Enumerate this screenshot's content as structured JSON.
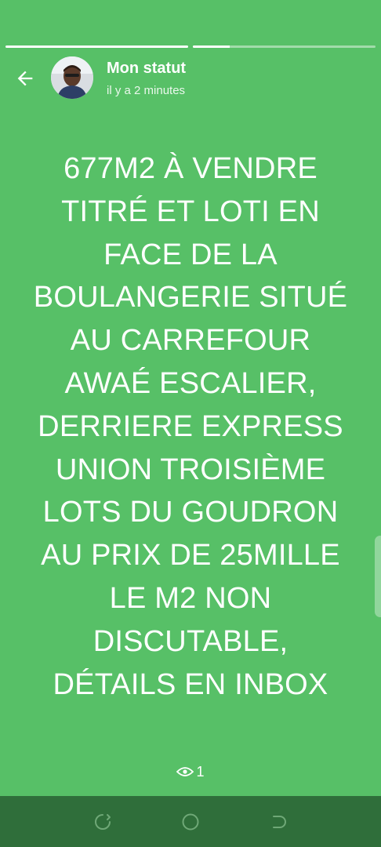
{
  "status": {
    "title": "Mon statut",
    "time": "il y a 2 minutes",
    "progress": [
      1.0,
      0.2
    ]
  },
  "story": {
    "text": "677M2 À VENDRE\nTITRÉ ET LOTI EN\nFACE DE LA\nBOULANGERIE SITUÉ\nAU CARREFOUR\nAWAÉ ESCALIER,\nDERRIERE EXPRESS\nUNION TROISIÈME\nLOTS DU GOUDRON\nAU PRIX DE 25MILLE\nLE M2 NON\nDISCUTABLE,\nDÉTAILS EN INBOX",
    "background_color": "#57c067"
  },
  "views": {
    "count": "1",
    "icon": "eye-icon"
  },
  "icons": {
    "back": "arrow-left-icon",
    "recent": "recent-apps-icon",
    "home": "home-icon",
    "back_nav": "back-icon"
  }
}
